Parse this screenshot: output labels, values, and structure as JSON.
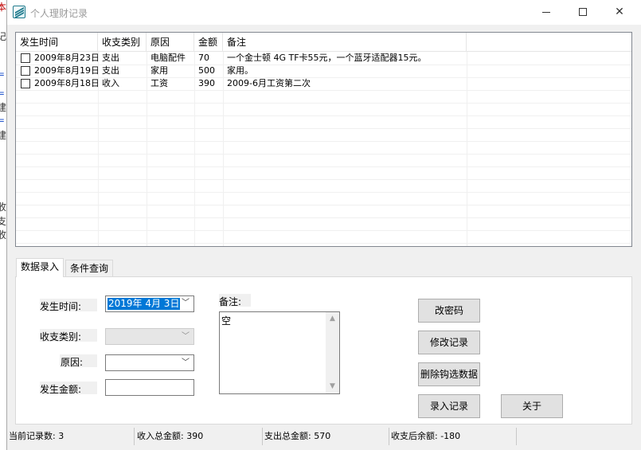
{
  "window": {
    "title": "个人理财记录"
  },
  "background_fragments": [
    "本",
    "记",
    "=",
    "=",
    "建",
    "=",
    "建",
    "收",
    "支",
    "收"
  ],
  "listview": {
    "columns": [
      "发生时间",
      "收支类别",
      "原因",
      "金额",
      "备注"
    ],
    "rows": [
      {
        "date": "2009年8月23日",
        "type": "支出",
        "reason": "电脑配件",
        "amount": "70",
        "note": "一个金士顿 4G TF卡55元，一个蓝牙适配器15元。",
        "checked": false
      },
      {
        "date": "2009年8月19日",
        "type": "支出",
        "reason": "家用",
        "amount": "500",
        "note": "家用。",
        "checked": false
      },
      {
        "date": "2009年8月18日",
        "type": "收入",
        "reason": "工资",
        "amount": "390",
        "note": "2009-6月工资第二次",
        "checked": false
      }
    ]
  },
  "tabs": [
    {
      "label": "数据录入",
      "active": true
    },
    {
      "label": "条件查询",
      "active": false
    }
  ],
  "form": {
    "date_label": "发生时间:",
    "date_value": "2019年 4月 3日",
    "type_label": "收支类别:",
    "type_value": "",
    "reason_label": "原因:",
    "reason_value": "",
    "amount_label": "发生金额:",
    "amount_value": "",
    "note_label": "备注:",
    "note_value": "空"
  },
  "buttons": {
    "change_password": "改密码",
    "modify_record": "修改记录",
    "delete_checked": "删除钩选数据",
    "add_record": "录入记录",
    "about": "关于"
  },
  "status": {
    "record_count": "当前记录数: 3",
    "income_total": "收入总金额: 390",
    "expense_total": "支出总金额: 570",
    "balance": "收支后余额: -180"
  }
}
